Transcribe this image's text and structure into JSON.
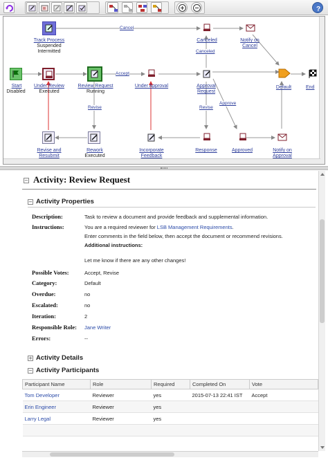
{
  "diagram": {
    "nodes": {
      "start": {
        "label": "Start",
        "status": "Disabled"
      },
      "under_review": {
        "label": "Under Review",
        "status": "Executed"
      },
      "review_request": {
        "label": "Review Request",
        "status": "Running"
      },
      "under_approval": {
        "label": "Under Approval"
      },
      "track_process": {
        "label": "Track Process",
        "status1": "Suspended",
        "status2": "Intermitted"
      },
      "canceled": {
        "label": "Canceled"
      },
      "notify_cancel": {
        "label": "Notify on Cancel"
      },
      "approval_request": {
        "label": "Approval Request"
      },
      "default": {
        "label": "Default"
      },
      "end": {
        "label": "End"
      },
      "revise_resubmit": {
        "label": "Revise and Resubmit"
      },
      "rework": {
        "label": "Rework",
        "status": "Executed"
      },
      "incorporate_feedback": {
        "label": "Incorporate Feedback"
      },
      "response": {
        "label": "Response"
      },
      "approved": {
        "label": "Approved"
      },
      "notify_approval": {
        "label": "Notify on Approval"
      }
    },
    "edges": {
      "cancel_top": "Cancel",
      "accept": "Accept",
      "revise": "Revise",
      "canceled": "Canceled",
      "revise2": "Revise",
      "approve": "Approve"
    }
  },
  "activity": {
    "title": "Activity: Review Request",
    "properties_title": "Activity Properties",
    "labels": {
      "description": "Description:",
      "instructions": "Instructions:",
      "possible_votes": "Possible Votes:",
      "category": "Category:",
      "overdue": "Overdue:",
      "escalated": "Escalated:",
      "iteration": "Iteration:",
      "responsible_role": "Responsible Role:",
      "errors": "Errors:"
    },
    "description": "Task to review a document and provide feedback and supplemental information.",
    "instructions_prefix": "You are a required reviewer for ",
    "instructions_link": "LSB Management Requirements",
    "instructions_suffix": ".",
    "instructions_line2": "Enter comments in the field below, then accept the document or recommend revisions.",
    "additional_instructions": "Additional instructions:",
    "additional_text": "Let me know if there are any other changes!",
    "possible_votes": "Accept, Revise",
    "category": "Default",
    "overdue": "no",
    "escalated": "no",
    "iteration": "2",
    "responsible_role": "Jane Writer",
    "errors": "--",
    "details_title": "Activity Details",
    "participants_title": "Activity Participants"
  },
  "participants": {
    "columns": [
      "Participant Name",
      "Role",
      "Required",
      "Completed On",
      "Vote"
    ],
    "rows": [
      [
        "Tom Developer",
        "Reviewer",
        "yes",
        "2015-07-13 22:41 IST",
        "Accept"
      ],
      [
        "Erin Engineer",
        "Reviewer",
        "yes",
        "",
        ""
      ],
      [
        "Larry Legal",
        "Reviewer",
        "yes",
        "",
        ""
      ]
    ]
  }
}
